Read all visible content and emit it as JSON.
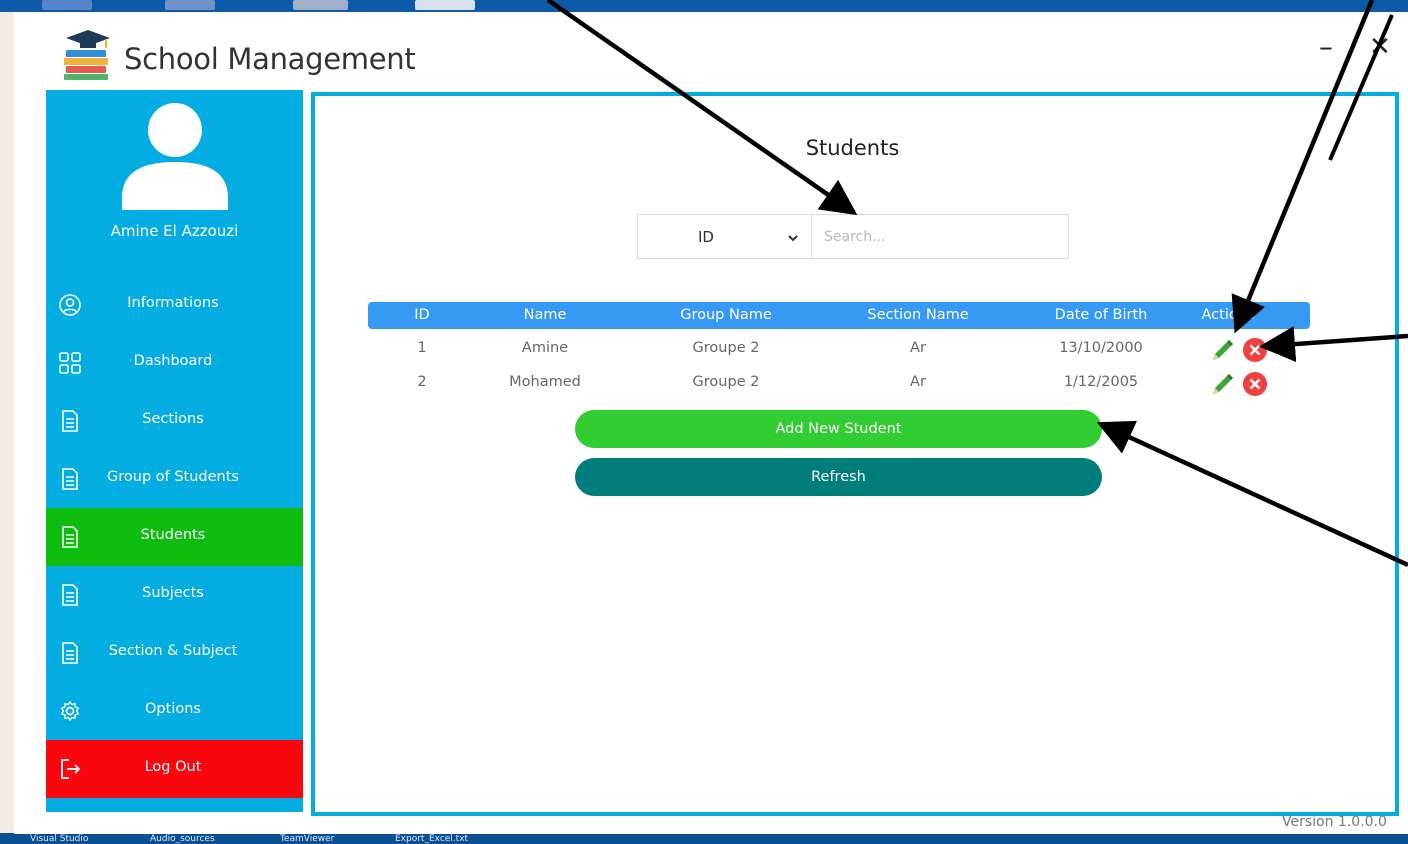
{
  "app": {
    "title": "School Management",
    "version": "Version 1.0.0.0",
    "minimize_glyph": "–",
    "close_glyph": "✕"
  },
  "desktop": {
    "taskbar_items": [
      "Visual Studio",
      "Audio_sources",
      "TeamViewer",
      "Export_Excel.txt"
    ]
  },
  "sidebar": {
    "user_name": "Amine El Azzouzi",
    "items": [
      {
        "label": "Informations",
        "icon": "user-circle-icon"
      },
      {
        "label": "Dashboard",
        "icon": "grid-icon"
      },
      {
        "label": "Sections",
        "icon": "document-icon"
      },
      {
        "label": "Group of Students",
        "icon": "document-icon"
      },
      {
        "label": "Students",
        "icon": "document-icon",
        "active": true
      },
      {
        "label": "Subjects",
        "icon": "document-icon"
      },
      {
        "label": "Section & Subject",
        "icon": "document-icon"
      },
      {
        "label": "Options",
        "icon": "gear-icon"
      },
      {
        "label": "Log Out",
        "icon": "logout-icon"
      }
    ]
  },
  "main": {
    "page_title": "Students",
    "filter": {
      "selected": "ID",
      "placeholder": "Search..."
    },
    "table": {
      "columns": [
        "ID",
        "Name",
        "Group Name",
        "Section Name",
        "Date of Birth",
        "Actions"
      ],
      "rows": [
        [
          "1",
          "Amine",
          "Groupe 2",
          "Ar",
          "13/10/2000"
        ],
        [
          "2",
          "Mohamed",
          "Groupe 2",
          "Ar",
          "1/12/2005"
        ]
      ]
    },
    "buttons": {
      "add": "Add New Student",
      "refresh": "Refresh"
    }
  },
  "colors": {
    "sidebar": "#03ade2",
    "active": "#0fbd11",
    "logout": "#f8080e",
    "table_header": "#3699f4",
    "add_button": "#32cd32",
    "refresh_button": "#017d7b",
    "delete_icon": "#f04040",
    "edit_icon": "#3aa83a"
  }
}
